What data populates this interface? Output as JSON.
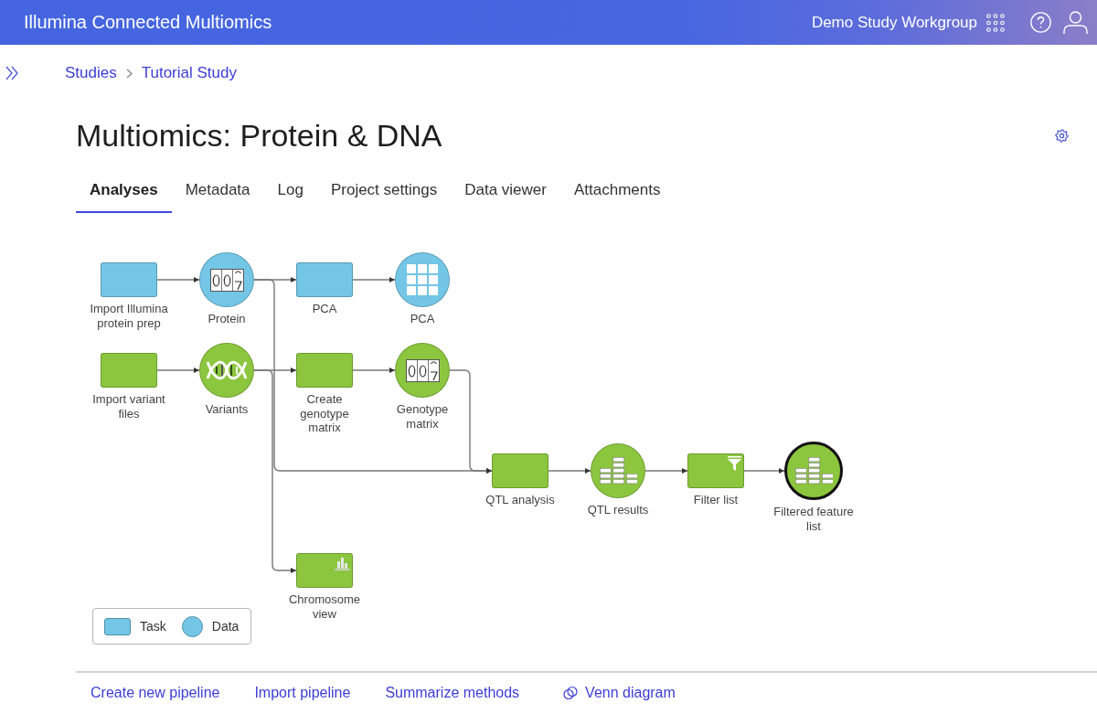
{
  "header": {
    "app_title": "Illumina Connected Multiomics",
    "workgroup": "Demo Study Workgroup"
  },
  "breadcrumbs": [
    "Studies",
    "Tutorial Study"
  ],
  "page_title": "Multiomics: Protein & DNA",
  "tabs": [
    {
      "label": "Analyses",
      "selected": true
    },
    {
      "label": "Metadata",
      "selected": false
    },
    {
      "label": "Log",
      "selected": false
    },
    {
      "label": "Project settings",
      "selected": false
    },
    {
      "label": "Data viewer",
      "selected": false
    },
    {
      "label": "Attachments",
      "selected": false
    }
  ],
  "pipeline": {
    "nodes": [
      {
        "label": "Import Illumina protein prep",
        "kind": "task",
        "color": "#74c6e6",
        "selected": false
      },
      {
        "label": "Protein",
        "kind": "matrix",
        "color": "#74c6e6",
        "selected": false
      },
      {
        "label": "PCA",
        "kind": "task",
        "color": "#74c6e6",
        "selected": false
      },
      {
        "label": "PCA",
        "kind": "pca",
        "color": "#74c6e6",
        "selected": false
      },
      {
        "label": "Import variant files",
        "kind": "task",
        "color": "#8cc63f",
        "selected": false
      },
      {
        "label": "Variants",
        "kind": "variants",
        "color": "#8cc63f",
        "selected": false
      },
      {
        "label": "Create genotype matrix",
        "kind": "task",
        "color": "#8cc63f",
        "selected": false
      },
      {
        "label": "Genotype matrix",
        "kind": "matrix",
        "color": "#8cc63f",
        "selected": false
      },
      {
        "label": "QTL analysis",
        "kind": "task",
        "color": "#8cc63f",
        "selected": false
      },
      {
        "label": "QTL results",
        "kind": "features",
        "color": "#8cc63f",
        "selected": false
      },
      {
        "label": "Filter list",
        "kind": "filter",
        "color": "#8cc63f",
        "selected": false
      },
      {
        "label": "Filtered feature list",
        "kind": "features",
        "color": "#8cc63f",
        "selected": true
      },
      {
        "label": "Chromosome view",
        "kind": "view",
        "color": "#8cc63f",
        "selected": false
      }
    ]
  },
  "legend": [
    {
      "kind": "task",
      "label": "Task"
    },
    {
      "kind": "data",
      "label": "Data"
    }
  ],
  "footer_links": [
    {
      "kind": "plain",
      "label": "Create new pipeline"
    },
    {
      "kind": "plain",
      "label": "Import pipeline"
    },
    {
      "kind": "plain",
      "label": "Summarize methods"
    },
    {
      "kind": "icon",
      "label": "Venn diagram"
    }
  ]
}
